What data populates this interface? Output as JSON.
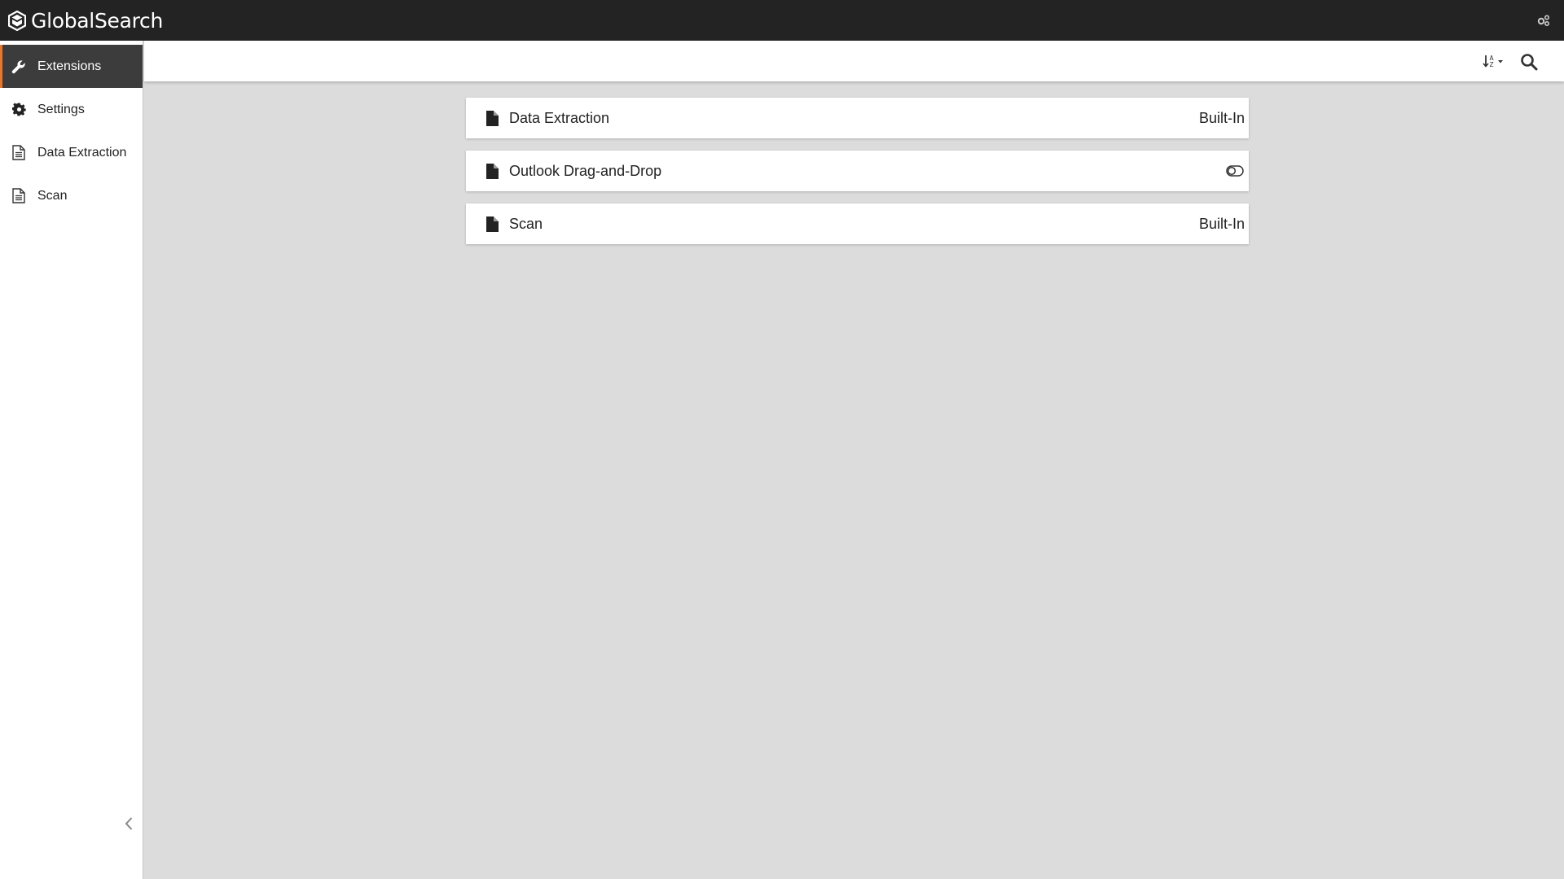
{
  "app": {
    "title": "GlobalSearch",
    "accent": "#e8772e"
  },
  "topbar": {
    "right_icon": "share-gears-icon"
  },
  "sidebar": {
    "items": [
      {
        "label": "Extensions",
        "icon": "wrench-icon",
        "active": true
      },
      {
        "label": "Settings",
        "icon": "gear-icon",
        "active": false
      },
      {
        "label": "Data Extraction",
        "icon": "document-outline-icon",
        "active": false
      },
      {
        "label": "Scan",
        "icon": "document-outline-icon",
        "active": false
      }
    ],
    "collapse_icon": "chevron-left-icon"
  },
  "toolbar": {
    "sort_icon": "sort-alpha-dropdown-icon",
    "search_icon": "search-icon"
  },
  "extensions": [
    {
      "name": "Data Extraction",
      "status": "Built-In",
      "icon": "file-icon"
    },
    {
      "name": "Outlook Drag-and-Drop",
      "status": "",
      "toggle": "off",
      "icon": "file-icon"
    },
    {
      "name": "Scan",
      "status": "Built-In",
      "icon": "file-icon"
    }
  ]
}
